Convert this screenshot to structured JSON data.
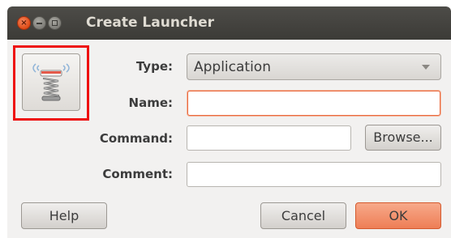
{
  "window": {
    "title": "Create Launcher",
    "controls": {
      "close_glyph": "×"
    }
  },
  "launcher_icon": {
    "icon_name": "spring-launcher-icon"
  },
  "form": {
    "type_label": "Type:",
    "type_value": "Application",
    "name_label": "Name:",
    "name_value": "",
    "command_label": "Command:",
    "command_value": "",
    "browse_label": "Browse...",
    "comment_label": "Comment:",
    "comment_value": ""
  },
  "buttons": {
    "help": "Help",
    "cancel": "Cancel",
    "ok": "OK"
  },
  "colors": {
    "accent": "#ee7e56",
    "focus_border": "#ea6a3e",
    "highlight": "#ee1111",
    "titlebar": "#3c3b37"
  }
}
